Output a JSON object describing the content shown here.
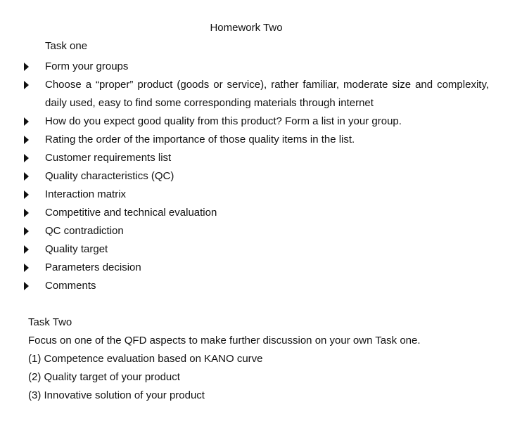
{
  "title": "Homework Two",
  "task_one": {
    "heading": "Task one",
    "items": [
      "Form your groups",
      "Choose a “proper” product (goods or service), rather familiar, moderate size and complexity, daily used, easy to find some corresponding materials through internet",
      "How do you expect good quality from this product? Form a list in your group.",
      "Rating the order of the importance of those quality items in the list.",
      "Customer requirements list",
      "Quality characteristics (QC)",
      "Interaction matrix",
      "Competitive and technical evaluation",
      "QC contradiction",
      "Quality target",
      "Parameters decision",
      "Comments"
    ]
  },
  "task_two": {
    "heading": "Task Two",
    "intro": "Focus on one of the QFD aspects to make further discussion on your own Task one.",
    "points": [
      "(1) Competence evaluation based on KANO curve",
      "(2) Quality target of your product",
      "(3) Innovative solution of your product"
    ]
  }
}
